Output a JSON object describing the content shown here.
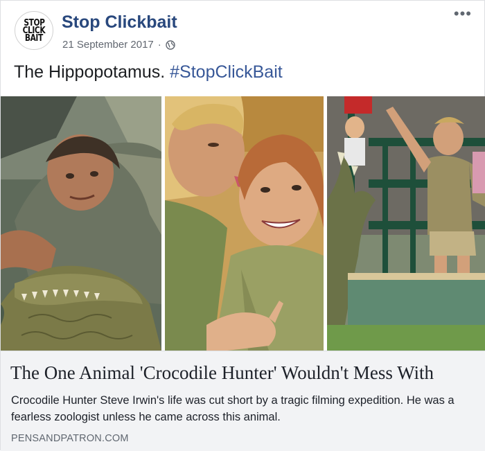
{
  "post": {
    "avatar_lines": [
      "STOP",
      "CLICK",
      "BAIT"
    ],
    "page_name": "Stop Clickbait",
    "date": "21 September 2017",
    "separator": "·",
    "privacy_icon": "globe-icon",
    "more_icon": "more-options-icon",
    "text": "The Hippopotamus.",
    "hashtag": "#StopClickBait"
  },
  "photos": [
    {
      "name": "photo-crocodile-hunter-on-crocodile"
    },
    {
      "name": "photo-couple-portrait"
    },
    {
      "name": "photo-crocodile-show"
    }
  ],
  "link": {
    "title": "The One Animal 'Crocodile Hunter' Wouldn't Mess With",
    "description": "Crocodile Hunter Steve Irwin's life was cut short by a tragic filming expedition. He was a fearless zoologist unless he came across this animal.",
    "domain": "PENSANDPATRON.COM"
  },
  "colors": {
    "page_name": "#29487d",
    "hashtag": "#385898",
    "link_box_bg": "#f2f3f5",
    "meta_text": "#616770"
  }
}
